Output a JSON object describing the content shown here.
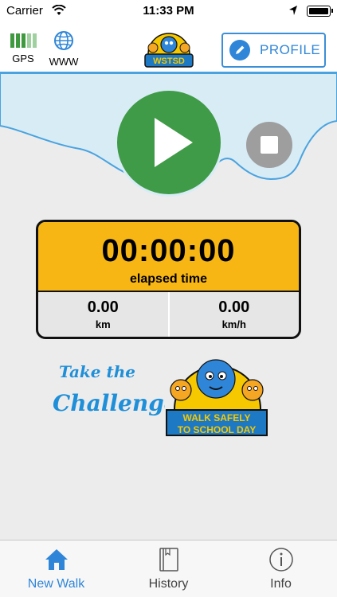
{
  "status_bar": {
    "carrier": "Carrier",
    "time": "11:33 PM"
  },
  "top_bar": {
    "gps_label": "GPS",
    "www_label": "WWW",
    "logo_text": "WSTSD",
    "profile_label": "PROFILE"
  },
  "timer": {
    "elapsed": "00:00:00",
    "elapsed_label": "elapsed time"
  },
  "stats": [
    {
      "value": "0.00",
      "unit": "km"
    },
    {
      "value": "0.00",
      "unit": "km/h"
    }
  ],
  "branding": {
    "challenge_line1": "Take the",
    "challenge_line2": "Challenge",
    "logo_line1": "WALK SAFELY",
    "logo_line2": "TO SCHOOL DAY"
  },
  "tabs": [
    {
      "label": "New Walk",
      "icon": "home-icon",
      "active": true
    },
    {
      "label": "History",
      "icon": "book-icon",
      "active": false
    },
    {
      "label": "Info",
      "icon": "info-icon",
      "active": false
    }
  ],
  "colors": {
    "accent": "#2f86d8",
    "play": "#3f9b47",
    "timer_bg": "#f7b614",
    "header_bg": "#d8ecf6"
  }
}
